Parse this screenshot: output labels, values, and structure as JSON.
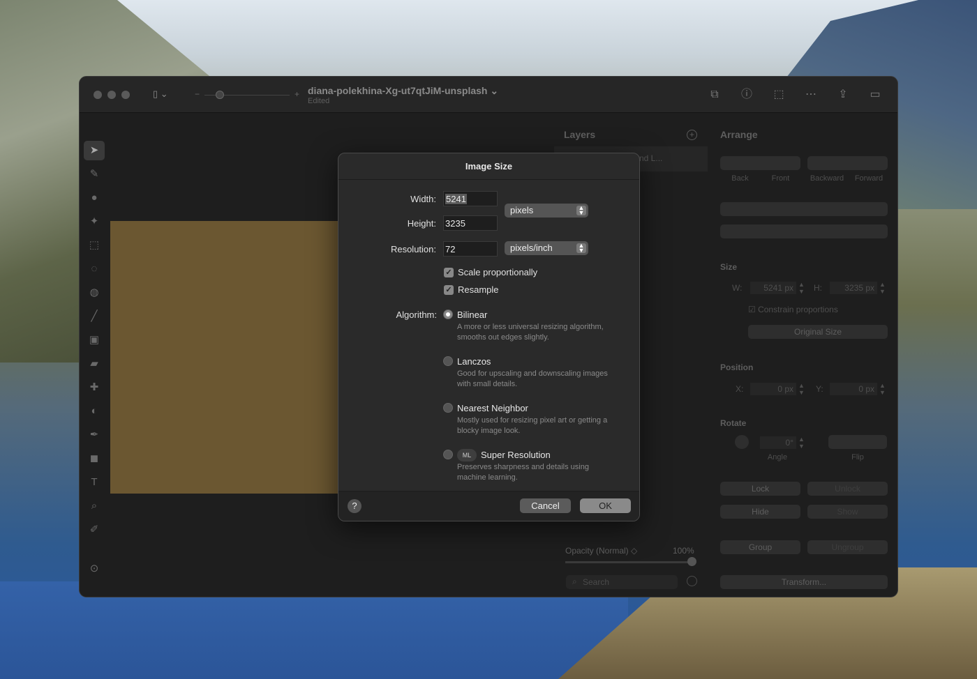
{
  "window": {
    "doc_title": "diana-polekhina-Xg-ut7qtJiM-unsplash",
    "doc_status": "Edited"
  },
  "layers": {
    "title": "Layers",
    "row_label": "nd L...",
    "opacity_label": "Opacity (Normal) ◇",
    "opacity_value": "100%",
    "search_placeholder": "Search"
  },
  "arrange": {
    "title": "Arrange",
    "order_labels": [
      "Back",
      "Front",
      "Backward",
      "Forward"
    ],
    "size_title": "Size",
    "w_label": "W:",
    "w_value": "5241 px",
    "h_label": "H:",
    "h_value": "3235 px",
    "constrain": "Constrain proportions",
    "original_size": "Original Size",
    "position_title": "Position",
    "x_label": "X:",
    "x_value": "0 px",
    "y_label": "Y:",
    "y_value": "0 px",
    "rotate_title": "Rotate",
    "angle_value": "0°",
    "angle_label": "Angle",
    "flip_label": "Flip",
    "lock": "Lock",
    "unlock": "Unlock",
    "hide": "Hide",
    "show": "Show",
    "group": "Group",
    "ungroup": "Ungroup",
    "transform": "Transform..."
  },
  "dialog": {
    "title": "Image Size",
    "width_label": "Width:",
    "width_value": "5241",
    "height_label": "Height:",
    "height_value": "3235",
    "size_unit": "pixels",
    "resolution_label": "Resolution:",
    "resolution_value": "72",
    "resolution_unit": "pixels/inch",
    "scale_proportionally": "Scale proportionally",
    "resample": "Resample",
    "algorithm_label": "Algorithm:",
    "algorithms": [
      {
        "name": "Bilinear",
        "desc": "A more or less universal resizing algorithm, smooths out edges slightly."
      },
      {
        "name": "Lanczos",
        "desc": "Good for upscaling and downscaling images with small details."
      },
      {
        "name": "Nearest Neighbor",
        "desc": "Mostly used for resizing pixel art or getting a blocky image look."
      },
      {
        "name": "Super Resolution",
        "desc": "Preserves sharpness and details using machine learning."
      }
    ],
    "ml_badge": "ML",
    "help": "?",
    "cancel": "Cancel",
    "ok": "OK"
  }
}
